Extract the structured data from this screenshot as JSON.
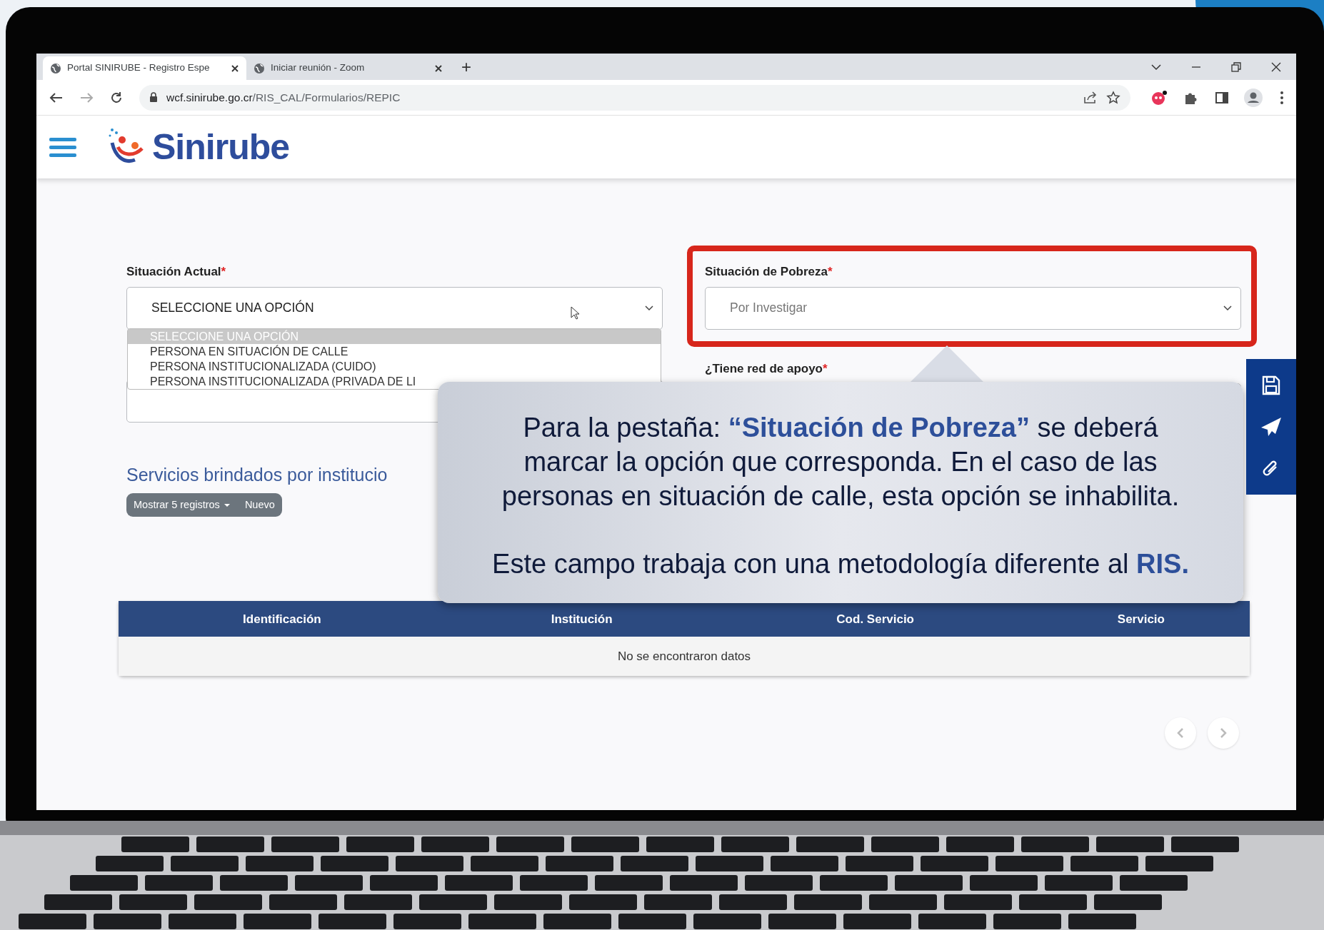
{
  "browser": {
    "tabs": [
      {
        "title": "Portal SINIRUBE - Registro Espe",
        "selected": true
      },
      {
        "title": "Iniciar reunión - Zoom",
        "selected": false
      }
    ],
    "new_tab": "+",
    "url": {
      "host": "wcf.sinirube.go.cr",
      "path": "/RIS_CAL/Formularios/REPIC"
    }
  },
  "header": {
    "logo_text": "Sinirube"
  },
  "form": {
    "situacion_actual": {
      "label": "Situación Actual",
      "required_marker": "*",
      "value": "SELECCIONE UNA OPCIÓN",
      "open": true,
      "options": [
        {
          "label": "SELECCIONE UNA OPCIÓN",
          "selected": true
        },
        {
          "label": "PERSONA EN SITUACIÓN DE CALLE",
          "selected": false
        },
        {
          "label": "PERSONA INSTITUCIONALIZADA (CUIDO)",
          "selected": false
        },
        {
          "label": "PERSONA INSTITUCIONALIZADA (PRIVADA DE LI",
          "selected": false
        }
      ]
    },
    "situacion_pobreza": {
      "label": "Situación de Pobreza",
      "required_marker": "*",
      "value": "Por Investigar",
      "disabled": true,
      "highlighted": true
    },
    "red_apoyo": {
      "label": "¿Tiene red de apoyo",
      "required_marker": "*"
    }
  },
  "services": {
    "title": "Servicios brindados por institucio",
    "buttons": [
      {
        "label": "Mostrar 5 registros",
        "kind": "dropdown"
      },
      {
        "label": "Nuevo",
        "kind": "plain"
      }
    ],
    "table": {
      "columns": [
        "Identificación",
        "Institución",
        "Cod. Servicio",
        "Servicio"
      ],
      "empty_message": "No se encontraron datos"
    }
  },
  "callout": {
    "paragraphs": [
      "Para la pestaña: **“Situación de Pobreza”** se deberá marcar la opción que corresponda. En el caso de las personas en situación de calle, esta opción se inhabilita.",
      "Este campo trabaja con una metodología diferente al **RIS.**"
    ]
  }
}
